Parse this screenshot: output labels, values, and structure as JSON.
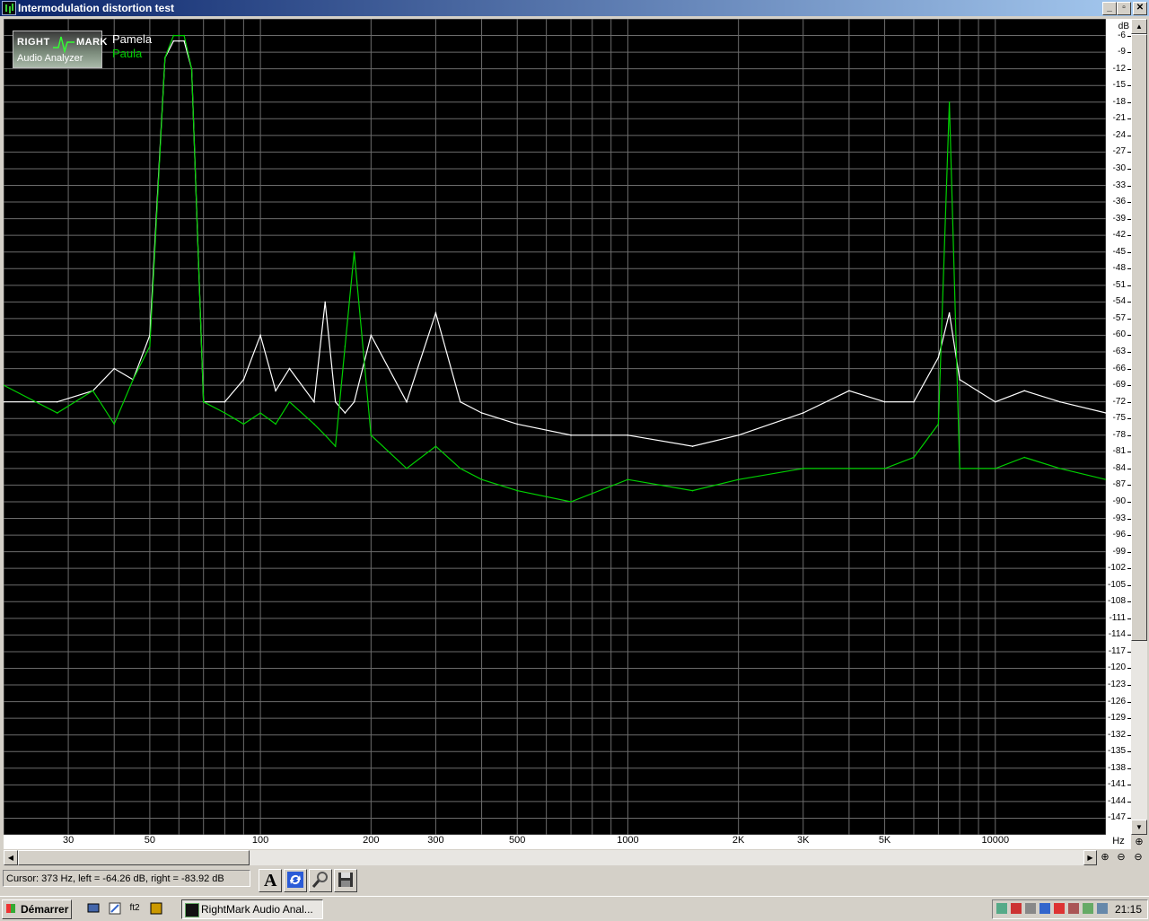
{
  "window": {
    "title": "Intermodulation distortion test",
    "controls": [
      "_",
      "▫",
      "✕"
    ]
  },
  "legend": {
    "series1": "Pamela",
    "series2": "Paula",
    "color1": "#ffffff",
    "color2": "#00d000"
  },
  "logo": {
    "line1": "RIGHT",
    "line2": "MARK",
    "line3": "Audio Analyzer"
  },
  "y_axis": {
    "unit": "dB",
    "labels": [
      "-6",
      "-9",
      "-12",
      "-15",
      "-18",
      "-21",
      "-24",
      "-27",
      "-30",
      "-33",
      "-36",
      "-39",
      "-42",
      "-45",
      "-48",
      "-51",
      "-54",
      "-57",
      "-60",
      "-63",
      "-66",
      "-69",
      "-72",
      "-75",
      "-78",
      "-81",
      "-84",
      "-87",
      "-90",
      "-93",
      "-96",
      "-99",
      "-102",
      "-105",
      "-108",
      "-111",
      "-114",
      "-117",
      "-120",
      "-123",
      "-126",
      "-129",
      "-132",
      "-135",
      "-138",
      "-141",
      "-144",
      "-147"
    ]
  },
  "x_axis": {
    "unit": "Hz",
    "labels": [
      {
        "f": 30,
        "t": "30"
      },
      {
        "f": 50,
        "t": "50"
      },
      {
        "f": 100,
        "t": "100"
      },
      {
        "f": 200,
        "t": "200"
      },
      {
        "f": 300,
        "t": "300"
      },
      {
        "f": 500,
        "t": "500"
      },
      {
        "f": 1000,
        "t": "1000"
      },
      {
        "f": 2000,
        "t": "2K"
      },
      {
        "f": 3000,
        "t": "3K"
      },
      {
        "f": 5000,
        "t": "5K"
      },
      {
        "f": 10000,
        "t": "10000"
      }
    ]
  },
  "chart_data": {
    "type": "line",
    "xscale": "log",
    "xlim": [
      20,
      20000
    ],
    "ylim": [
      -150,
      -3
    ],
    "grid": true,
    "legend_position": "top-left",
    "series": [
      {
        "name": "Pamela",
        "x": [
          20,
          28,
          35,
          40,
          45,
          50,
          55,
          58,
          60,
          62,
          65,
          70,
          80,
          90,
          100,
          110,
          120,
          140,
          150,
          160,
          170,
          180,
          200,
          250,
          300,
          350,
          400,
          500,
          700,
          1000,
          1500,
          2000,
          3000,
          4000,
          5000,
          6000,
          7000,
          7500,
          8000,
          10000,
          12000,
          15000,
          20000
        ],
        "y": [
          -72,
          -72,
          -70,
          -66,
          -68,
          -60,
          -10,
          -7,
          -7,
          -7,
          -12,
          -72,
          -72,
          -68,
          -60,
          -70,
          -66,
          -72,
          -54,
          -72,
          -74,
          -72,
          -60,
          -72,
          -56,
          -72,
          -74,
          -76,
          -78,
          -78,
          -80,
          -78,
          -74,
          -70,
          -72,
          -72,
          -64,
          -56,
          -68,
          -72,
          -70,
          -72,
          -74
        ]
      },
      {
        "name": "Paula",
        "x": [
          20,
          28,
          35,
          40,
          45,
          50,
          55,
          58,
          60,
          62,
          65,
          70,
          80,
          90,
          100,
          110,
          120,
          140,
          150,
          160,
          170,
          180,
          200,
          250,
          300,
          350,
          400,
          500,
          700,
          1000,
          1500,
          2000,
          3000,
          4000,
          5000,
          6000,
          7000,
          7500,
          8000,
          10000,
          12000,
          15000,
          20000
        ],
        "y": [
          -69,
          -74,
          -70,
          -76,
          -68,
          -62,
          -10,
          -6,
          -6,
          -6,
          -12,
          -72,
          -74,
          -76,
          -74,
          -76,
          -72,
          -76,
          -78,
          -80,
          -62,
          -45,
          -78,
          -84,
          -80,
          -84,
          -86,
          -88,
          -90,
          -86,
          -88,
          -86,
          -84,
          -84,
          -84,
          -82,
          -76,
          -18,
          -84,
          -84,
          -82,
          -84,
          -86
        ]
      }
    ]
  },
  "hz_label": "Hz",
  "zoom_icons": [
    "zoom-in-icon",
    "zoom-in-icon",
    "zoom-out-icon",
    "zoom-out-icon"
  ],
  "status": {
    "cursor_text": "Cursor:  373 Hz,  left = -64.26 dB,  right = -83.92 dB"
  },
  "taskbar": {
    "start_label": "Démarrer",
    "task_label": "RightMark Audio Anal...",
    "clock": "21:15",
    "quicklaunch_text": "ft2"
  }
}
